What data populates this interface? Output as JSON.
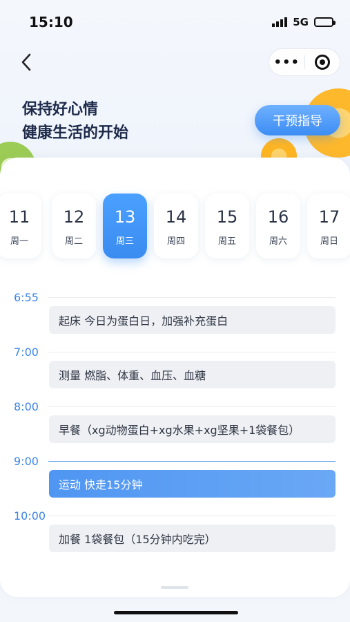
{
  "status_bar": {
    "time": "15:10",
    "network": "5G"
  },
  "header": {
    "slogan_line1": "保持好心情",
    "slogan_line2": "健康生活的开始",
    "intervene_button": "干预指导"
  },
  "week": {
    "days": [
      {
        "num": "11",
        "weekday": "周一",
        "active": false
      },
      {
        "num": "12",
        "weekday": "周二",
        "active": false
      },
      {
        "num": "13",
        "weekday": "周三",
        "active": true
      },
      {
        "num": "14",
        "weekday": "周四",
        "active": false
      },
      {
        "num": "15",
        "weekday": "周五",
        "active": false
      },
      {
        "num": "16",
        "weekday": "周六",
        "active": false
      },
      {
        "num": "17",
        "weekday": "周日",
        "active": false
      }
    ]
  },
  "schedule": [
    {
      "time": "6:55",
      "event": "起床  今日为蛋白日，加强补充蛋白",
      "active": false
    },
    {
      "time": "7:00",
      "event": "测量 燃脂、体重、血压、血糖",
      "active": false
    },
    {
      "time": "8:00",
      "event": "早餐（xg动物蛋白+xg水果+xg坚果+1袋餐包）",
      "active": false
    },
    {
      "time": "9:00",
      "event": "运动 快走15分钟",
      "active": true
    },
    {
      "time": "10:00",
      "event": "加餐 1袋餐包（15分钟内吃完）",
      "active": false
    }
  ],
  "icons": {
    "back": "chevron-left-icon",
    "more": "more-dots-icon",
    "close": "target-circle-icon",
    "signal": "signal-icon",
    "battery": "battery-icon"
  },
  "colors": {
    "accent": "#3c8df4",
    "time_label": "#3b86e6",
    "event_bg": "#eef0f4"
  }
}
